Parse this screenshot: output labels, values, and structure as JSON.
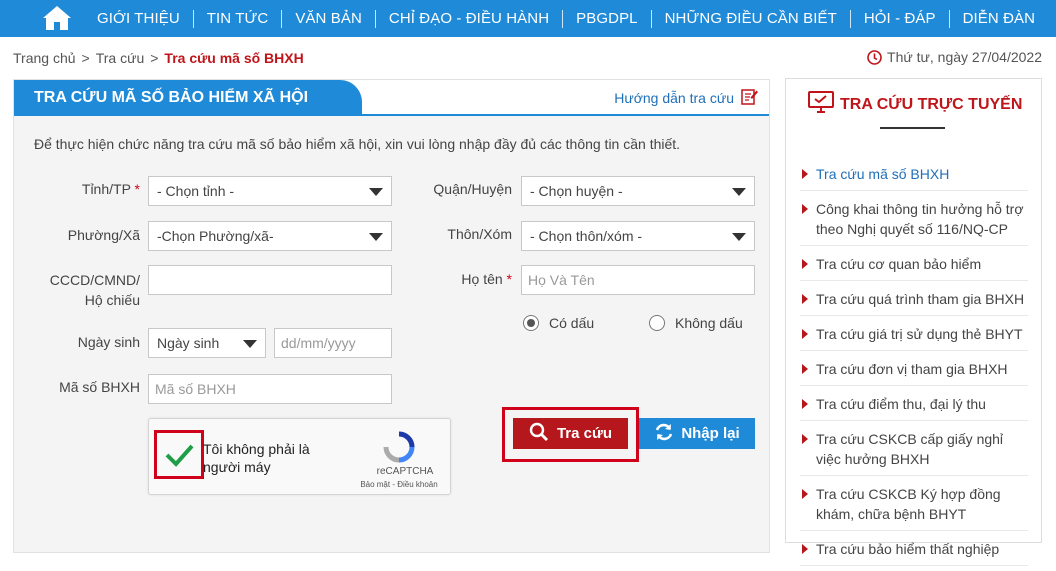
{
  "nav": {
    "items": [
      "GIỚI THIỆU",
      "TIN TỨC",
      "VĂN BẢN",
      "CHỈ ĐẠO - ĐIỀU HÀNH",
      "PBGDPL",
      "NHỮNG ĐIỀU CẦN BIẾT",
      "HỎI - ĐÁP",
      "DIỄN ĐÀN"
    ],
    "home_icon": "home-icon"
  },
  "breadcrumb": {
    "home": "Trang chủ",
    "parent": "Tra cứu",
    "current": "Tra cứu mã số BHXH",
    "separator": ">"
  },
  "date": "Thứ tư, ngày 27/04/2022",
  "panel": {
    "title": "TRA CỨU MÃ SỐ BẢO HIỂM XÃ HỘI",
    "guide": "Hướng dẫn tra cứu",
    "intro": "Để thực hiện chức năng tra cứu mã số bảo hiểm xã hội, xin vui lòng nhập đầy đủ các thông tin cần thiết."
  },
  "form": {
    "province_label": "Tỉnh/TP",
    "province_value": "- Chọn tỉnh -",
    "district_label": "Quận/Huyện",
    "district_value": "- Chọn huyện -",
    "ward_label": "Phường/Xã",
    "ward_value": "-Chọn Phường/xã-",
    "hamlet_label": "Thôn/Xóm",
    "hamlet_value": "- Chọn thôn/xóm -",
    "id_label_1": "CCCD/CMND/",
    "id_label_2": "Hộ chiếu",
    "id_value": "",
    "name_label": "Họ tên",
    "name_placeholder": "Họ Và Tên",
    "required_mark": "*",
    "radio_accent": "Có dấu",
    "radio_no_accent": "Không dấu",
    "dob_label": "Ngày sinh",
    "dob_select": "Ngày sinh",
    "dob_placeholder": "dd/mm/yyyy",
    "bhxh_label": "Mã số BHXH",
    "bhxh_placeholder": "Mã số BHXH"
  },
  "captcha": {
    "text": "Tôi không phải là người máy",
    "brand": "reCAPTCHA",
    "links": "Bảo mật - Điều khoản",
    "checked": true
  },
  "buttons": {
    "search": "Tra cứu",
    "reset": "Nhập lại"
  },
  "side": {
    "title": "TRA CỨU TRỰC TUYẾN",
    "items": [
      "Tra cứu mã số BHXH",
      "Công khai thông tin hưởng hỗ trợ theo Nghị quyết số 116/NQ-CP",
      "Tra cứu cơ quan bảo hiểm",
      "Tra cứu quá trình tham gia BHXH",
      "Tra cứu giá trị sử dụng thẻ BHYT",
      "Tra cứu đơn vị tham gia BHXH",
      "Tra cứu điểm thu, đại lý thu",
      "Tra cứu CSKCB cấp giấy nghỉ việc hưởng BHXH",
      "Tra cứu CSKCB Ký hợp đồng khám, chữa bệnh BHYT",
      "Tra cứu bảo hiểm thất nghiệp"
    ]
  },
  "colors": {
    "primary": "#1f8ad8",
    "accent_red": "#c0141b",
    "button_red": "#b5171c",
    "highlight_box": "#d0021b"
  }
}
